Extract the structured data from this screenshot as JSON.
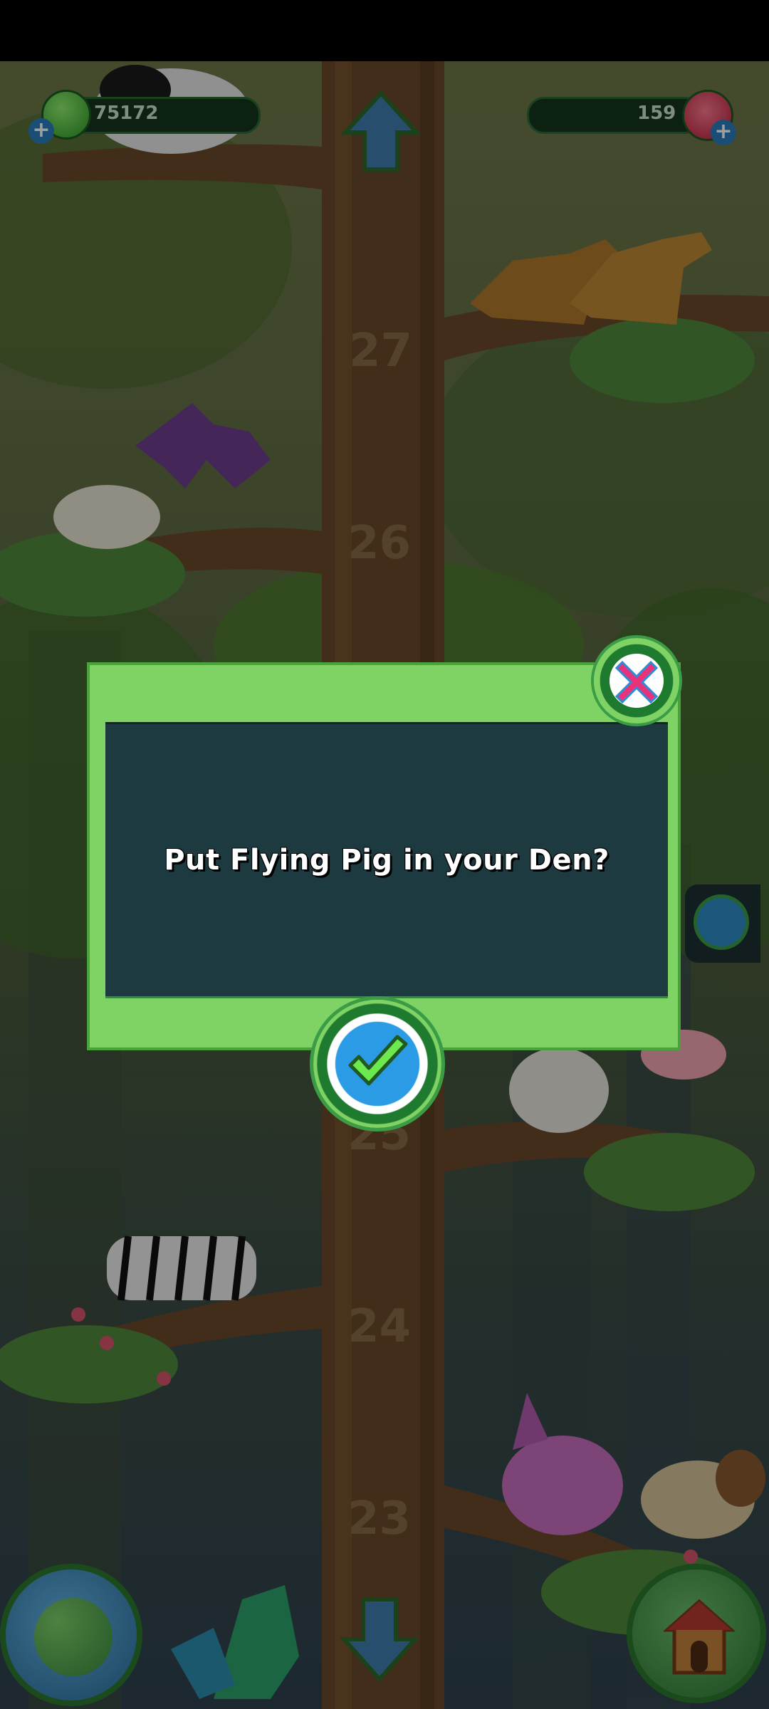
{
  "hud": {
    "coins": "75172",
    "gems": "159"
  },
  "dialog": {
    "message": "Put Flying Pig in your Den?"
  },
  "tree": {
    "levels": [
      "27",
      "26",
      "25",
      "24",
      "23"
    ]
  },
  "icons": {
    "coin": "green-coin-icon",
    "gem": "red-gem-icon",
    "close": "close-x-icon",
    "confirm": "check-icon",
    "map": "globe-icon",
    "den": "house-icon",
    "up": "up-arrow-icon",
    "down": "down-arrow-icon",
    "den-side": "den-side-icon"
  },
  "colors": {
    "dialog_frame": "#7fd264",
    "dialog_panel": "#1d3a40",
    "close_accent": "#e8337a",
    "confirm_accent": "#2f9be0"
  }
}
